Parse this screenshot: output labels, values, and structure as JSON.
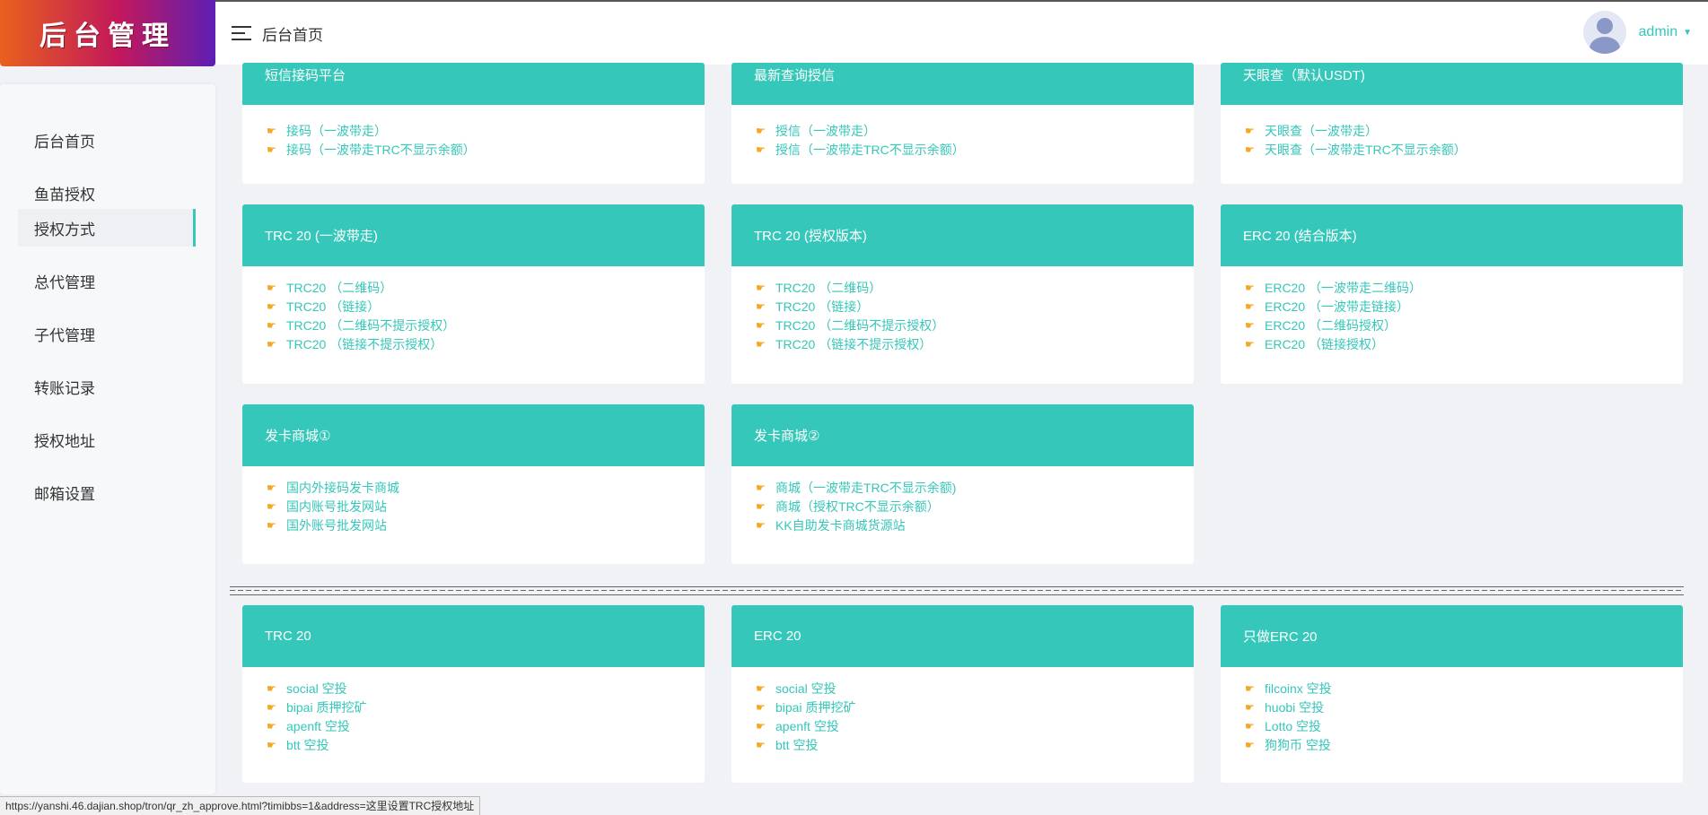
{
  "logo_text": "后台管理",
  "header": {
    "title": "后台首页",
    "username": "admin",
    "menu_icon": "hamburger-icon",
    "caret_icon": "caret-down-icon"
  },
  "sidebar": {
    "items": [
      {
        "label": "后台首页"
      },
      {
        "label": "鱼苗授权"
      },
      {
        "label": "授权方式",
        "active": true
      },
      {
        "label": "总代管理"
      },
      {
        "label": "子代管理"
      },
      {
        "label": "转账记录"
      },
      {
        "label": "授权地址"
      },
      {
        "label": "邮箱设置"
      }
    ]
  },
  "link_icon": "pointing-hand-icon",
  "accent_color": "#35c7b9",
  "cards": [
    {
      "title": "短信接码平台",
      "links": [
        "接码（一波带走）",
        "接码（一波带走TRC不显示余额）"
      ]
    },
    {
      "title": "最新查询授信",
      "links": [
        "授信（一波带走）",
        "授信（一波带走TRC不显示余额）"
      ]
    },
    {
      "title": "天眼查（默认USDT)",
      "links": [
        "天眼查（一波带走）",
        "天眼查（一波带走TRC不显示余额）"
      ]
    },
    {
      "title": "TRC 20 (一波带走)",
      "links": [
        "TRC20 （二维码）",
        "TRC20 （链接）",
        "TRC20 （二维码不提示授权）",
        "TRC20 （链接不提示授权）"
      ]
    },
    {
      "title": "TRC 20 (授权版本)",
      "links": [
        "TRC20 （二维码）",
        "TRC20 （链接）",
        "TRC20 （二维码不提示授权）",
        "TRC20 （链接不提示授权）"
      ]
    },
    {
      "title": "ERC 20 (结合版本)",
      "links": [
        "ERC20 （一波带走二维码）",
        "ERC20 （一波带走链接）",
        "ERC20 （二维码授权）",
        "ERC20 （链接授权）"
      ]
    },
    {
      "title": "发卡商城①",
      "links": [
        "国内外接码发卡商城",
        "国内账号批发网站",
        "国外账号批发网站"
      ]
    },
    {
      "title": "发卡商城②",
      "links": [
        "商城（一波带走TRC不显示余额)",
        "商城（授权TRC不显示余额）",
        "KK自助发卡商城货源站"
      ]
    },
    {
      "title": "TRC 20",
      "links": [
        "social 空投",
        "bipai 质押挖矿",
        "apenft 空投",
        "btt 空投"
      ]
    },
    {
      "title": "ERC 20",
      "links": [
        "social 空投",
        "bipai 质押挖矿",
        "apenft 空投",
        "btt 空投"
      ]
    },
    {
      "title": "只做ERC 20",
      "links": [
        "filcoinx 空投",
        "huobi 空投",
        "Lotto 空投",
        "狗狗币 空投"
      ]
    }
  ],
  "status_url": "https://yanshi.46.dajian.shop/tron/qr_zh_approve.html?timibbs=1&address=这里设置TRC授权地址"
}
